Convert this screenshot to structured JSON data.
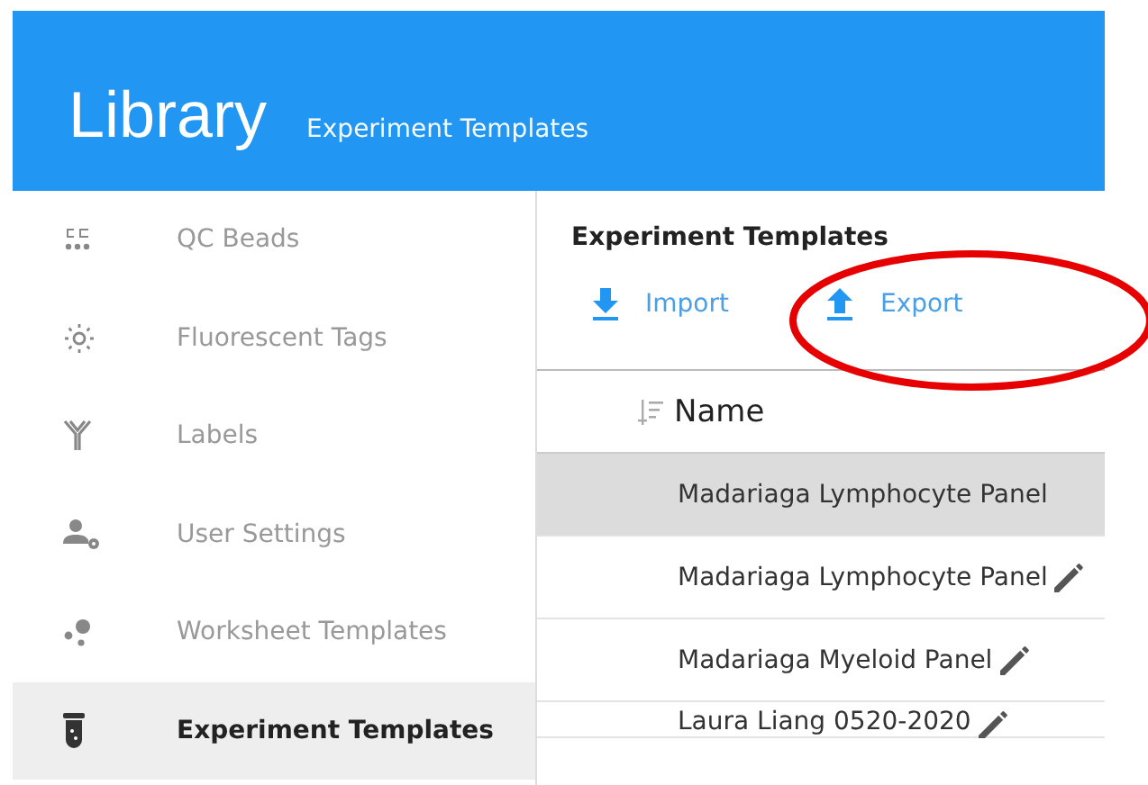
{
  "header": {
    "title": "Library",
    "subtitle": "Experiment Templates"
  },
  "sidebar": {
    "items": [
      {
        "label": "QC Beads",
        "selected": false
      },
      {
        "label": "Fluorescent Tags",
        "selected": false
      },
      {
        "label": "Labels",
        "selected": false
      },
      {
        "label": "User Settings",
        "selected": false
      },
      {
        "label": "Worksheet Templates",
        "selected": false
      },
      {
        "label": "Experiment Templates",
        "selected": true
      }
    ]
  },
  "content": {
    "title": "Experiment Templates",
    "toolbar": [
      {
        "label": "Import",
        "kind": "download",
        "highlighted": false
      },
      {
        "label": "Export",
        "kind": "upload",
        "highlighted": true
      }
    ],
    "table": {
      "columns": [
        "Name"
      ],
      "rows": [
        {
          "name": "Madariaga Lymphocyte Panel",
          "selected": true,
          "editable": false
        },
        {
          "name": "Madariaga Lymphocyte Panel",
          "selected": false,
          "editable": true
        },
        {
          "name": "Madariaga Myeloid Panel",
          "selected": false,
          "editable": true
        },
        {
          "name": "Laura Liang 0520-2020",
          "selected": false,
          "editable": true
        }
      ]
    }
  }
}
